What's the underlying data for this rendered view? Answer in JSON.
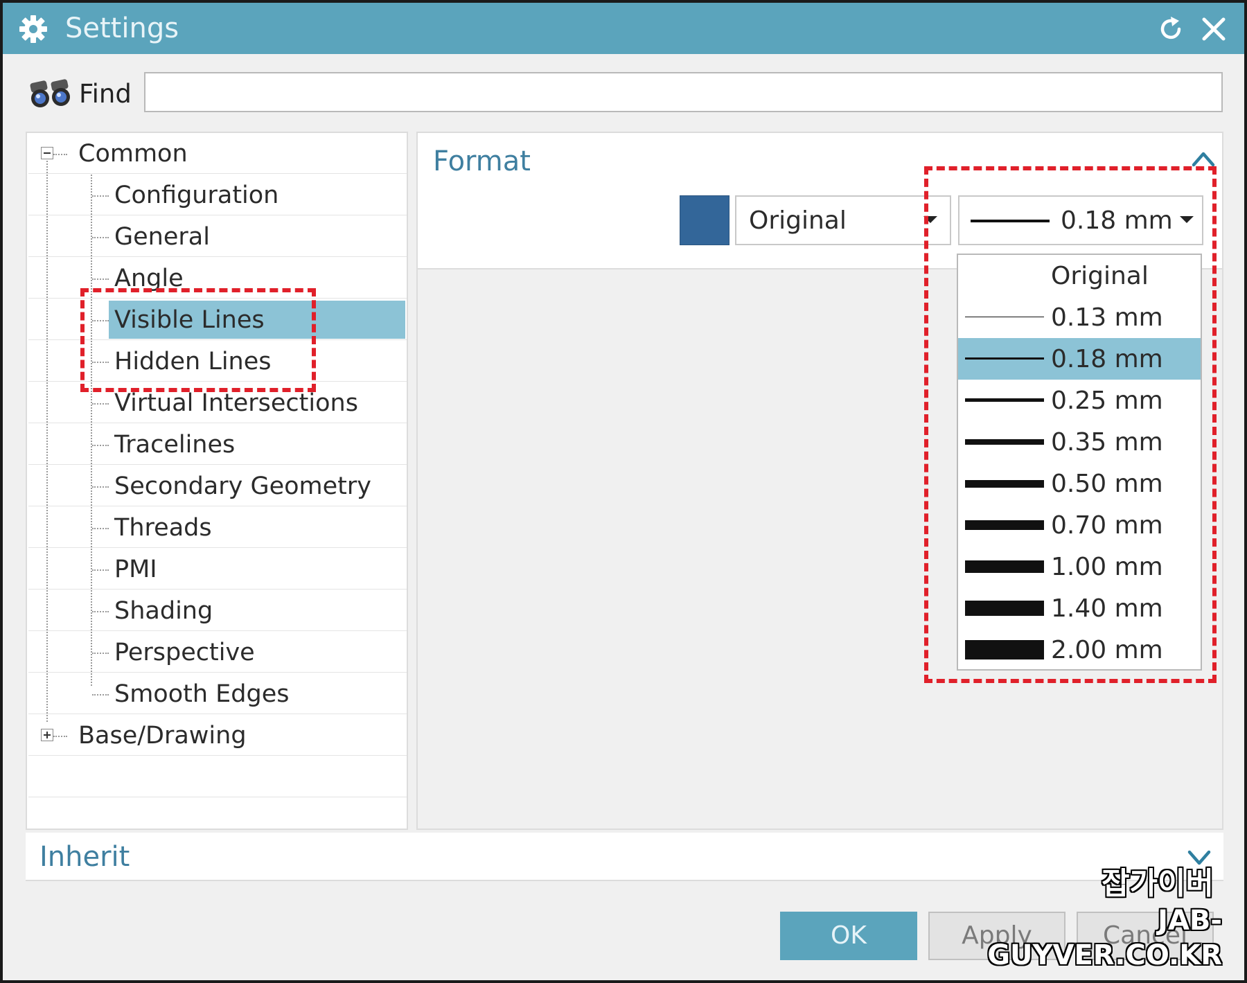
{
  "window": {
    "title": "Settings"
  },
  "find": {
    "label": "Find",
    "value": ""
  },
  "tree": {
    "root_common": "Common",
    "children": [
      "Configuration",
      "General",
      "Angle",
      "Visible Lines",
      "Hidden Lines",
      "Virtual Intersections",
      "Tracelines",
      "Secondary Geometry",
      "Threads",
      "PMI",
      "Shading",
      "Perspective",
      "Smooth Edges"
    ],
    "root_base": "Base/Drawing",
    "selected": "Visible Lines"
  },
  "format": {
    "title": "Format",
    "color": "#336699",
    "font_value": "Original",
    "width_value": "0.18 mm",
    "width_options": [
      "Original",
      "0.13 mm",
      "0.18 mm",
      "0.25 mm",
      "0.35 mm",
      "0.50 mm",
      "0.70 mm",
      "1.00 mm",
      "1.40 mm",
      "2.00 mm"
    ],
    "selected_width": "0.18 mm"
  },
  "inherit": {
    "title": "Inherit"
  },
  "buttons": {
    "ok": "OK",
    "apply": "Apply",
    "cancel": "Cancel"
  },
  "colors": {
    "titlebar": "#5ba4bc",
    "selection": "#8cc3d6",
    "section_title": "#3f7fa0",
    "highlight": "#e0202a"
  },
  "watermark": {
    "korean": "잡가이버",
    "url": "JAB-GUYVER.CO.KR"
  }
}
